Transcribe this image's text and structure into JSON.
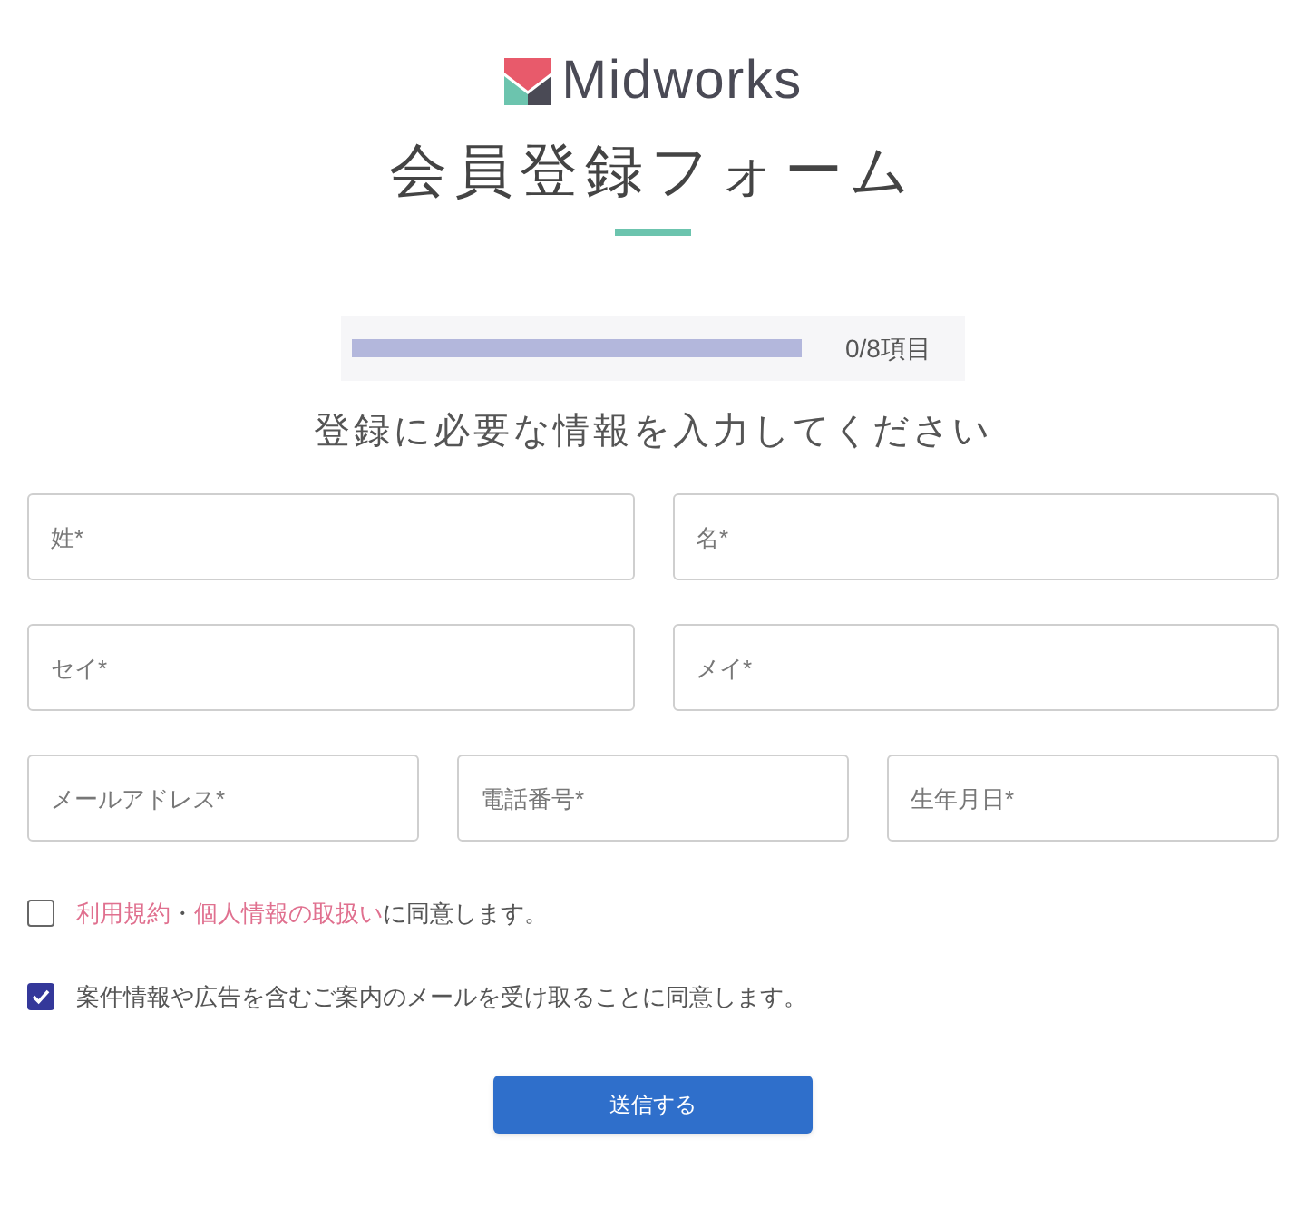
{
  "logo": {
    "text": "Midworks"
  },
  "title": "会員登録フォーム",
  "progress": {
    "level": 0,
    "reading": "0/8項目"
  },
  "heading": "登録に必要な情報を入力してください",
  "field_rows": [
    [
      {
        "placeholder": "姓*"
      },
      {
        "placeholder": "名*"
      }
    ],
    [
      {
        "placeholder": "セイ*"
      },
      {
        "placeholder": "メイ*"
      }
    ],
    [
      {
        "placeholder": "メールアドレス*"
      },
      {
        "placeholder": "電話番号*"
      },
      {
        "placeholder": "生年月日*"
      }
    ]
  ],
  "checkboxes": [
    {
      "checked": false,
      "parts": [
        {
          "kind": "link",
          "text": "利用規約"
        },
        {
          "kind": "text",
          "text": "・"
        },
        {
          "kind": "link",
          "text": "個人情報の取扱い"
        },
        {
          "kind": "text",
          "text": "に同意します。"
        }
      ]
    },
    {
      "checked": true,
      "parts": [
        {
          "kind": "text",
          "text": "案件情報や広告を含むご案内のメールを受け取ることに同意します。"
        }
      ]
    }
  ],
  "submit_button": "送信する"
}
